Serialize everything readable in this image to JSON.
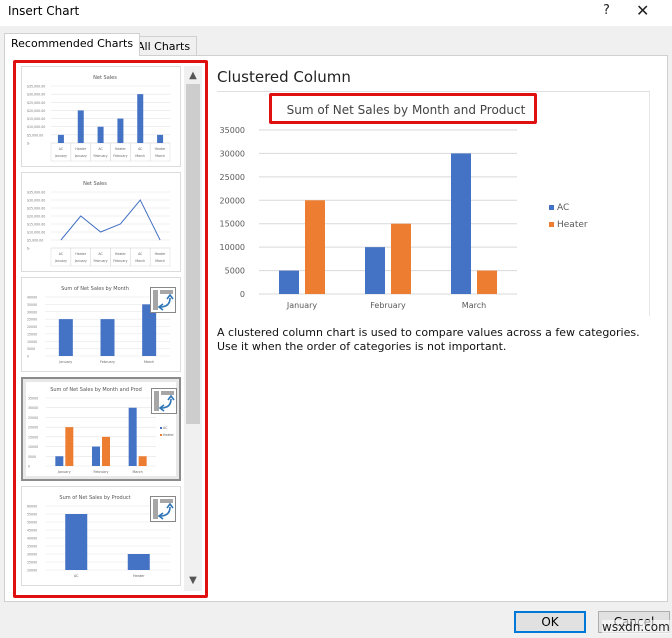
{
  "window": {
    "title": "Insert Chart",
    "help_label": "?",
    "close_label": "✕"
  },
  "tabs": [
    {
      "label": "Recommended Charts",
      "active": true
    },
    {
      "label": "All Charts",
      "active": false
    }
  ],
  "thumbnails": [
    {
      "title": "Net Sales",
      "type": "bar",
      "yticks": [
        "$35,000.00",
        "$30,000.00",
        "$25,000.00",
        "$20,000.00",
        "$15,000.00",
        "$10,000.00",
        "$5,000.00",
        "$-"
      ],
      "categories": [
        [
          "AC",
          "January"
        ],
        [
          "Heater",
          "January"
        ],
        [
          "AC",
          "February"
        ],
        [
          "Heater",
          "February"
        ],
        [
          "AC",
          "March"
        ],
        [
          "Heater",
          "March"
        ]
      ],
      "values": [
        5000,
        20000,
        10000,
        15000,
        30000,
        5000
      ],
      "pivot": false
    },
    {
      "title": "Net Sales",
      "type": "line",
      "yticks": [
        "$35,000.00",
        "$30,000.00",
        "$25,000.00",
        "$20,000.00",
        "$15,000.00",
        "$10,000.00",
        "$5,000.00",
        "$-"
      ],
      "categories": [
        [
          "AC",
          "January"
        ],
        [
          "Heater",
          "January"
        ],
        [
          "AC",
          "February"
        ],
        [
          "Heater",
          "February"
        ],
        [
          "AC",
          "March"
        ],
        [
          "Heater",
          "March"
        ]
      ],
      "values": [
        5000,
        20000,
        10000,
        15000,
        30000,
        5000
      ],
      "pivot": false
    },
    {
      "title": "Sum of Net Sales by Month",
      "type": "bar",
      "yticks": [
        "40000",
        "35000",
        "30000",
        "25000",
        "20000",
        "15000",
        "10000",
        "5000",
        "0"
      ],
      "categories": [
        [
          "January"
        ],
        [
          "February"
        ],
        [
          "March"
        ]
      ],
      "values": [
        25000,
        25000,
        35000
      ],
      "pivot": true
    },
    {
      "title": "Sum of Net Sales by Month and Prod",
      "type": "clustered",
      "yticks": [
        "35000",
        "30000",
        "25000",
        "20000",
        "15000",
        "10000",
        "5000",
        "0"
      ],
      "categories": [
        [
          "January"
        ],
        [
          "February"
        ],
        [
          "March"
        ]
      ],
      "series": [
        {
          "name": "AC",
          "values": [
            5000,
            10000,
            30000
          ]
        },
        {
          "name": "Heater",
          "values": [
            20000,
            15000,
            5000
          ]
        }
      ],
      "pivot": true,
      "selected": true
    },
    {
      "title": "Sum of Net Sales by Product",
      "type": "bar",
      "yticks": [
        "60000",
        "55000",
        "50000",
        "45000",
        "40000",
        "35000",
        "30000",
        "25000",
        "20000"
      ],
      "categories": [
        [
          "AC"
        ],
        [
          "Heater"
        ]
      ],
      "values": [
        55000,
        30000
      ],
      "pivot": true
    }
  ],
  "preview": {
    "chart_type_name": "Clustered Column",
    "description": "A clustered column chart is used to compare values across a few categories. Use it when the order of categories is not important."
  },
  "chart_data": {
    "type": "bar",
    "title": "Sum of Net Sales by Month and Product",
    "categories": [
      "January",
      "February",
      "March"
    ],
    "series": [
      {
        "name": "AC",
        "values": [
          5000,
          10000,
          30000
        ],
        "color": "#4472c4"
      },
      {
        "name": "Heater",
        "values": [
          20000,
          15000,
          5000
        ],
        "color": "#ed7d31"
      }
    ],
    "yticks": [
      0,
      5000,
      10000,
      15000,
      20000,
      25000,
      30000,
      35000
    ],
    "ylim": [
      0,
      35000
    ],
    "xlabel": "",
    "ylabel": "",
    "grid": true,
    "legend": "right"
  },
  "colors": {
    "highlight": "#e01010",
    "ac": "#4472c4",
    "heater": "#ed7d31"
  },
  "buttons": {
    "ok": "OK",
    "cancel": "Cancel"
  },
  "watermark": "wsxdn.com"
}
